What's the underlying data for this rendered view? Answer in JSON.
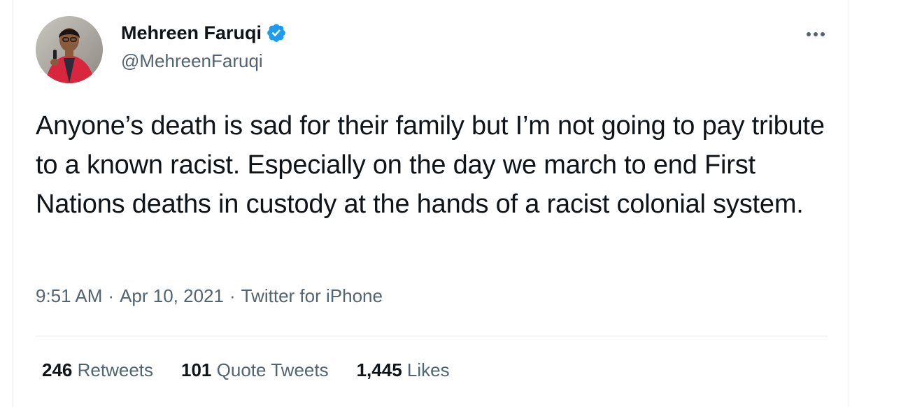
{
  "author": {
    "name": "Mehreen Faruqi",
    "handle": "@MehreenFaruqi",
    "verified": true,
    "avatar": "profile-photo"
  },
  "menu_icon": "more-horizontal-icon",
  "tweet": {
    "text": "Anyone’s death is sad for their family but I’m not going to pay tribute to a known racist. Especially on the day we march to end First Nations deaths in custody at the hands of a racist colonial system."
  },
  "meta": {
    "time": "9:51 AM",
    "separator": "·",
    "date": "Apr 10, 2021",
    "source": "Twitter for iPhone"
  },
  "stats": {
    "retweets": {
      "count": "246",
      "label": "Retweets"
    },
    "quotes": {
      "count": "101",
      "label": "Quote Tweets"
    },
    "likes": {
      "count": "1,445",
      "label": "Likes"
    }
  },
  "colors": {
    "text": "#0f1419",
    "secondary": "#536471",
    "verified": "#1d9bf0",
    "divider": "#e6e9eb"
  }
}
